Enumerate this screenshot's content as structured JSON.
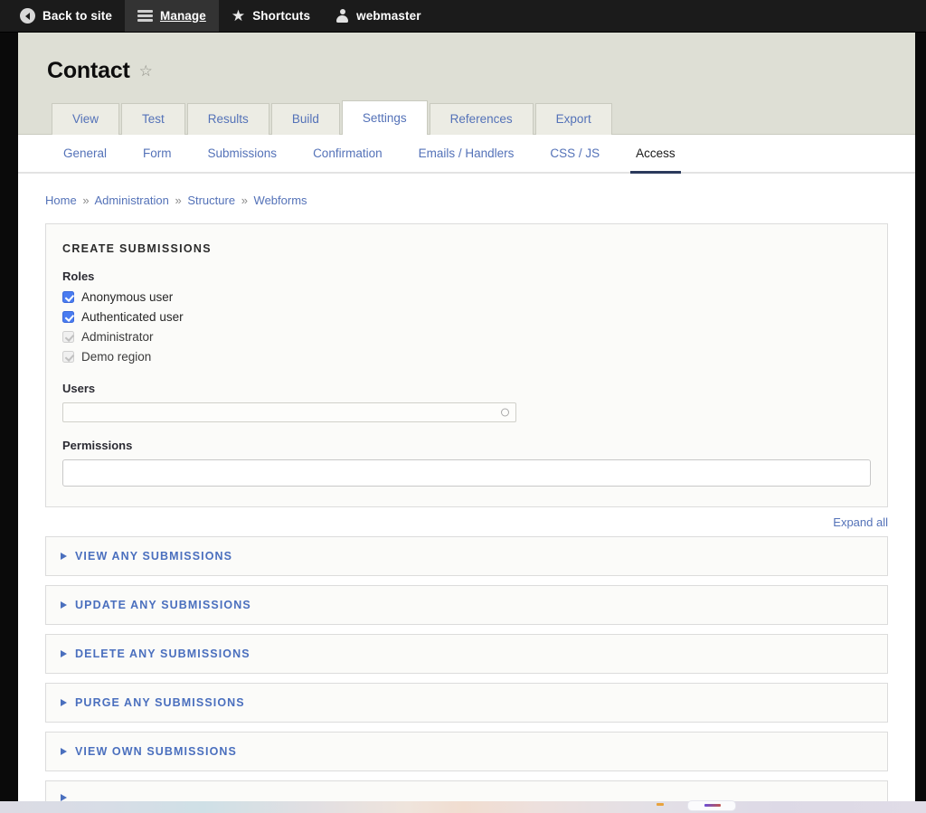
{
  "toolbar": {
    "back_to_site": "Back to site",
    "manage": "Manage",
    "shortcuts": "Shortcuts",
    "account": "webmaster",
    "icons": {
      "back": "back-circle-icon",
      "manage": "hamburger-icon",
      "shortcuts": "star-icon",
      "account": "person-icon"
    }
  },
  "page": {
    "title": "Contact",
    "favorite_icon": "star-outline-icon"
  },
  "primary_tabs": [
    {
      "label": "View",
      "active": false
    },
    {
      "label": "Test",
      "active": false
    },
    {
      "label": "Results",
      "active": false
    },
    {
      "label": "Build",
      "active": false
    },
    {
      "label": "Settings",
      "active": true
    },
    {
      "label": "References",
      "active": false
    },
    {
      "label": "Export",
      "active": false
    }
  ],
  "secondary_tabs": [
    {
      "label": "General",
      "active": false
    },
    {
      "label": "Form",
      "active": false
    },
    {
      "label": "Submissions",
      "active": false
    },
    {
      "label": "Confirmation",
      "active": false
    },
    {
      "label": "Emails / Handlers",
      "active": false
    },
    {
      "label": "CSS / JS",
      "active": false
    },
    {
      "label": "Access",
      "active": true
    }
  ],
  "breadcrumb": {
    "items": [
      "Home",
      "Administration",
      "Structure",
      "Webforms"
    ],
    "separator": "»"
  },
  "create_submissions": {
    "legend": "Create submissions",
    "roles_label": "Roles",
    "roles": [
      {
        "label": "Anonymous user",
        "checked": true,
        "disabled": false
      },
      {
        "label": "Authenticated user",
        "checked": true,
        "disabled": false
      },
      {
        "label": "Administrator",
        "checked": true,
        "disabled": true
      },
      {
        "label": "Demo region",
        "checked": true,
        "disabled": true
      }
    ],
    "users_label": "Users",
    "users_value": "",
    "users_placeholder": "",
    "permissions_label": "Permissions",
    "permissions_value": "",
    "permissions_placeholder": ""
  },
  "expand_all": "Expand all",
  "accordions": [
    {
      "label": "View any submissions"
    },
    {
      "label": "Update any submissions"
    },
    {
      "label": "Delete any submissions"
    },
    {
      "label": "Purge any submissions"
    },
    {
      "label": "View own submissions"
    },
    {
      "label": ""
    }
  ],
  "colors": {
    "toolbar_bg": "#1b1b1b",
    "header_bg": "#dedfd5",
    "link_blue": "#5472b8",
    "accent_checkbox": "#4a7cf0",
    "active_underline": "#2b3a5c",
    "card_bg": "#fbfbf9",
    "card_border": "#dcdcdc"
  }
}
